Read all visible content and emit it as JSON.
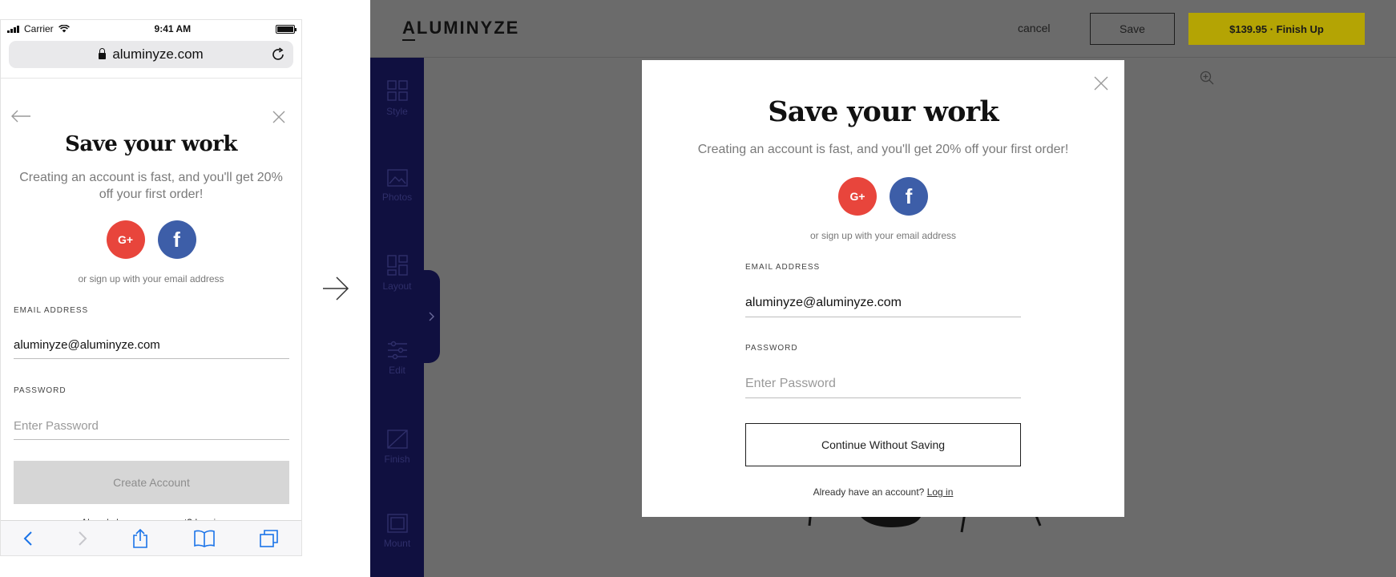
{
  "mobile": {
    "status": {
      "carrier": "Carrier",
      "time": "9:41 AM"
    },
    "url": "aluminyze.com",
    "title": "Save your work",
    "subtitle": "Creating an account is fast, and you'll get 20% off your first order!",
    "or_text": "or sign up with your email address",
    "email_label": "EMAIL ADDRESS",
    "email_value": "aluminyze@aluminyze.com",
    "password_label": "PASSWORD",
    "password_placeholder": "Enter Password",
    "create_button": "Create Account",
    "login_prompt": "Already have an account?",
    "login_link": "Log in",
    "social_icons": [
      "google-plus-icon",
      "facebook-icon"
    ]
  },
  "desktop": {
    "logo": "ALUMINYZE",
    "header": {
      "cancel": "cancel",
      "save": "Save",
      "finish": "$139.95 · Finish Up"
    },
    "sidebar": [
      {
        "label": "Style",
        "icon": "grid-icon"
      },
      {
        "label": "Photos",
        "icon": "photo-icon"
      },
      {
        "label": "Layout",
        "icon": "layout-icon"
      },
      {
        "label": "Edit",
        "icon": "sliders-icon"
      },
      {
        "label": "Finish",
        "icon": "finish-icon"
      },
      {
        "label": "Mount",
        "icon": "mount-icon"
      }
    ],
    "modal": {
      "title": "Save your work",
      "subtitle": "Creating an account is fast, and you'll get 20% off your first order!",
      "or_text": "or sign up with your email address",
      "email_label": "EMAIL ADDRESS",
      "email_value": "aluminyze@aluminyze.com",
      "password_label": "PASSWORD",
      "password_placeholder": "Enter Password",
      "continue_button": "Continue Without Saving",
      "login_prompt": "Already have an account?",
      "login_link": "Log in"
    }
  },
  "colors": {
    "google": "#e8453c",
    "facebook": "#3d5ea8",
    "finish_button": "#b4a404",
    "sidebar": "#101040",
    "overlay": "#6b6b6b"
  }
}
